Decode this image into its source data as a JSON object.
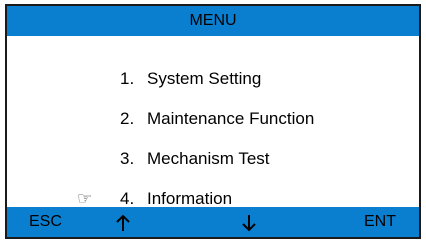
{
  "titlebar": {
    "title": "MENU"
  },
  "menu": {
    "items": [
      {
        "number": "1.",
        "label": "System Setting",
        "selected": false
      },
      {
        "number": "2.",
        "label": "Maintenance Function",
        "selected": false
      },
      {
        "number": "3.",
        "label": "Mechanism Test",
        "selected": false
      },
      {
        "number": "4.",
        "label": "Information",
        "selected": true
      }
    ],
    "pointer_icon": "pointing-hand-icon"
  },
  "bottombar": {
    "esc_label": "ESC",
    "up_icon": "arrow-up-icon",
    "down_icon": "arrow-down-icon",
    "ent_label": "ENT"
  },
  "colors": {
    "bar": "#0a7fcf",
    "background": "#ffffff",
    "text": "#000000"
  }
}
